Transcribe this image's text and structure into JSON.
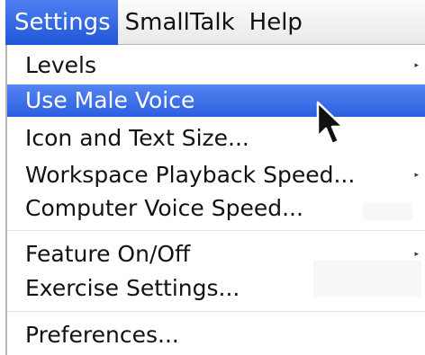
{
  "menubar": {
    "items": [
      {
        "label": "Settings",
        "active": true
      },
      {
        "label": "SmallTalk",
        "active": false
      },
      {
        "label": "Help",
        "active": false
      }
    ]
  },
  "menu": {
    "items": [
      {
        "label": "Levels",
        "submenu": true,
        "highlighted": false
      },
      {
        "label": "Use Male Voice",
        "submenu": false,
        "highlighted": true
      },
      {
        "label": "Icon and Text Size...",
        "submenu": false,
        "highlighted": false
      },
      {
        "label": "Workspace Playback Speed...",
        "submenu": true,
        "highlighted": false
      },
      {
        "label": "Computer Voice Speed...",
        "submenu": false,
        "highlighted": false
      },
      {
        "label": "Feature On/Off",
        "submenu": true,
        "highlighted": false
      },
      {
        "label": "Exercise Settings...",
        "submenu": false,
        "highlighted": false
      },
      {
        "label": "Preferences...",
        "submenu": false,
        "highlighted": false
      }
    ],
    "submenu_glyph": "▸"
  },
  "colors": {
    "highlight": "#2a5fe0",
    "menubar_bg": "#eeeeee",
    "text": "#121212"
  },
  "icons": {
    "cursor": "arrow-cursor-icon",
    "submenu": "chevron-right-icon"
  }
}
